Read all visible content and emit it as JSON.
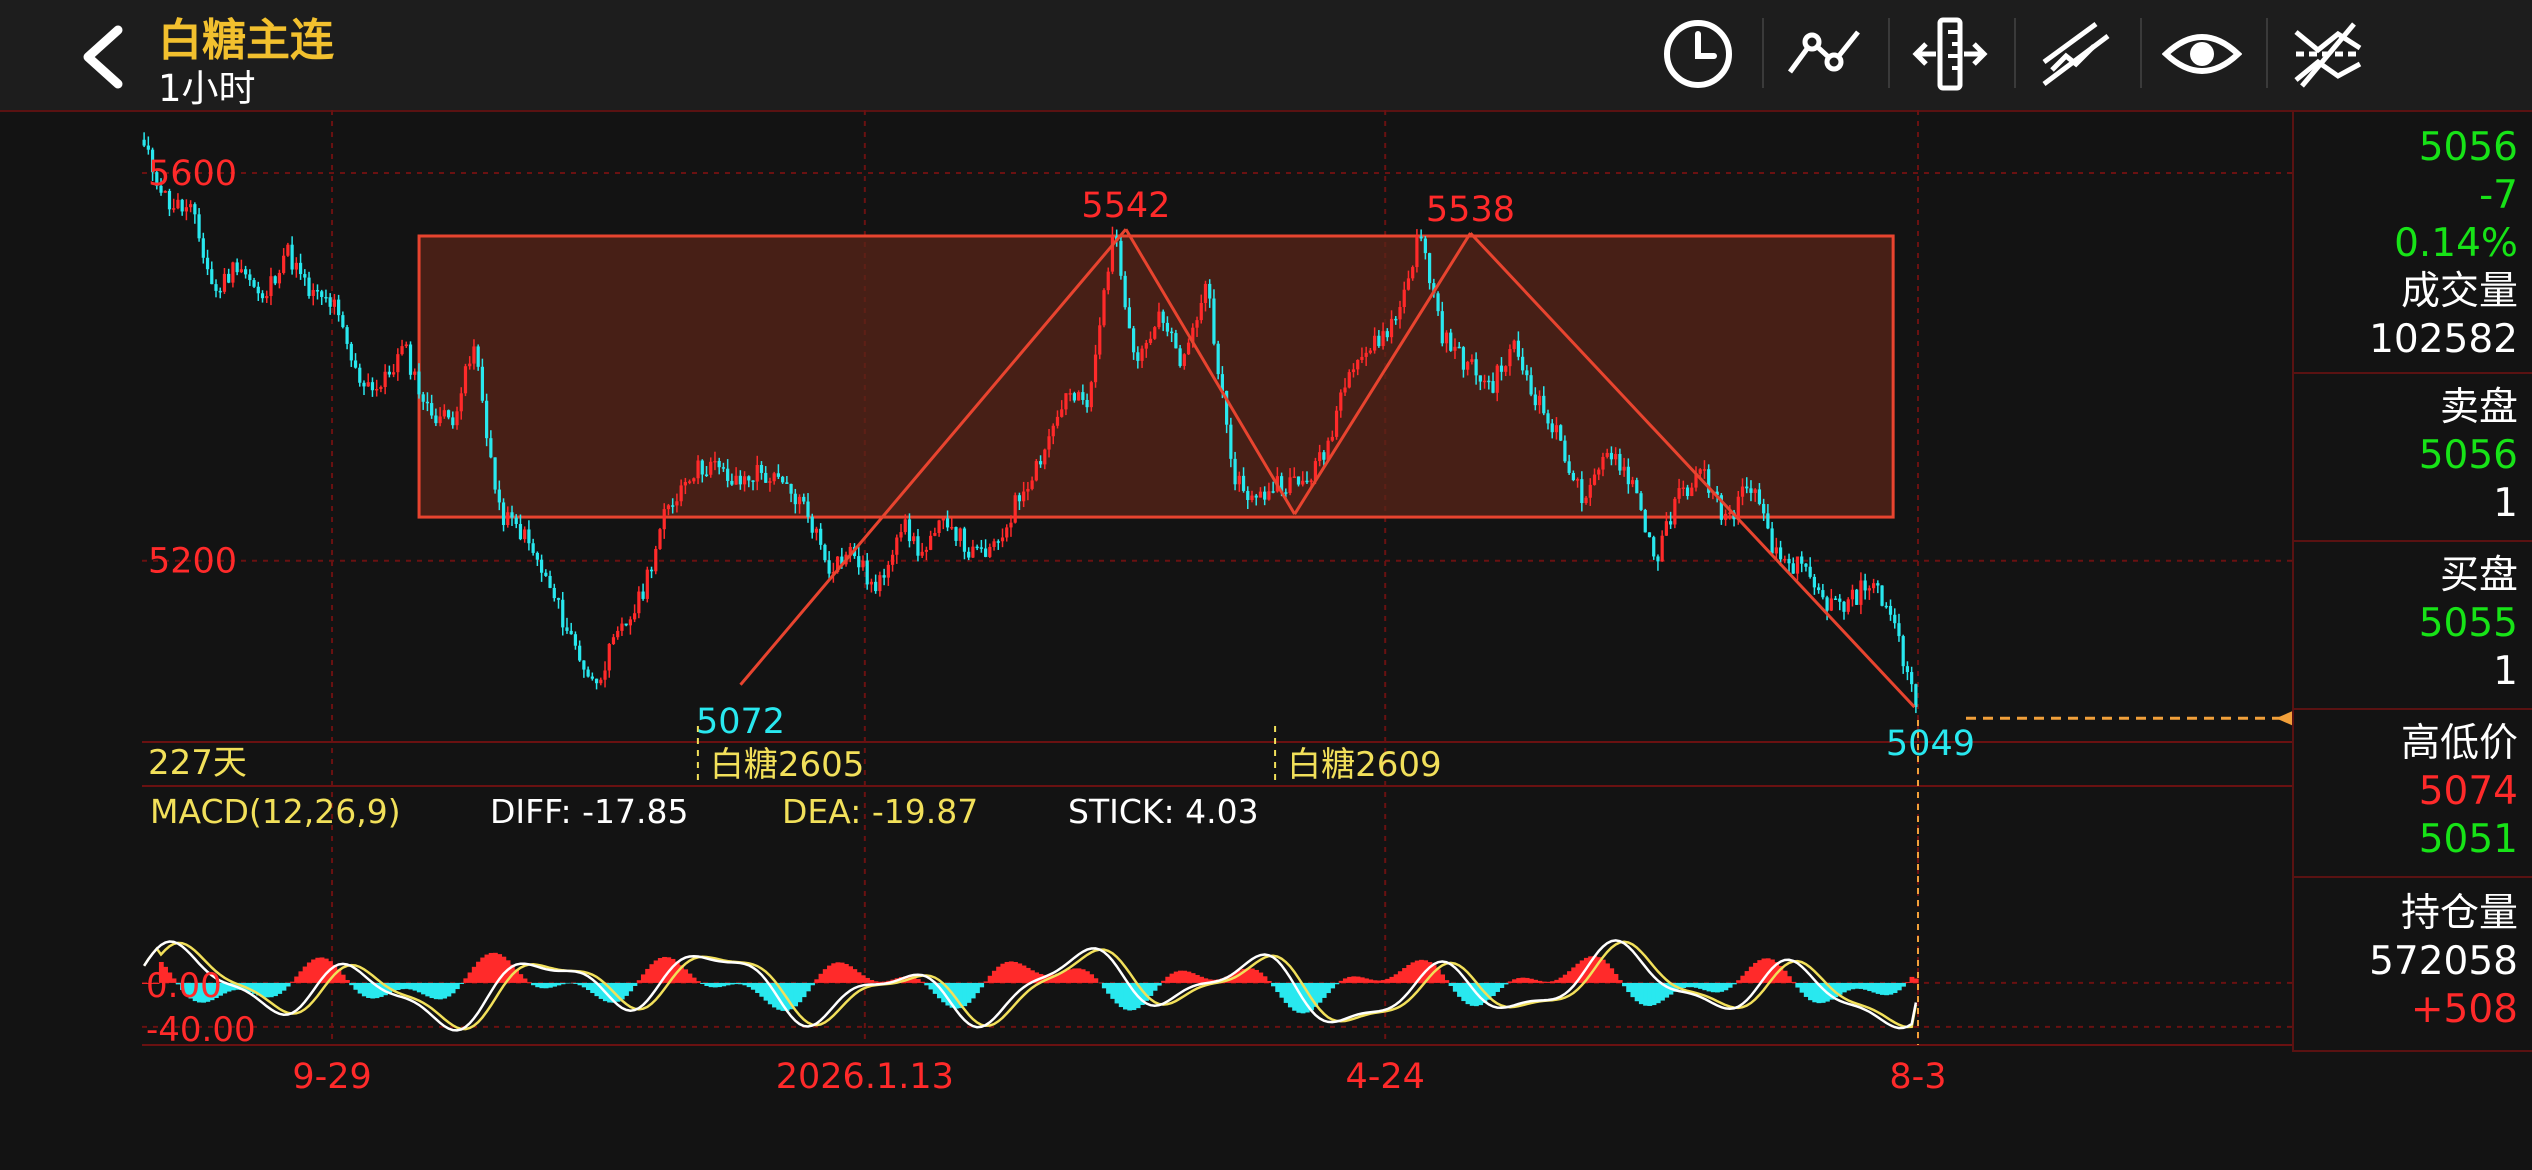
{
  "header": {
    "title": "白糖主连",
    "subtitle": "1小时",
    "tools": [
      "clock-icon",
      "line-draw-icon",
      "ruler-icon",
      "parallel-lines-icon",
      "eye-icon",
      "hide-drawings-icon"
    ]
  },
  "colors": {
    "up": "#ff2a2a",
    "down": "#29e8ef",
    "box_stroke": "#e8442f",
    "box_fill": "#5a2418",
    "diff_line": "#ffffff",
    "dea_line": "#f2e05a",
    "grid": "#6a1111",
    "price_green": "#17e317",
    "yellow": "#f2e05a",
    "orange": "#f2a03a"
  },
  "side": {
    "last_price": "5056",
    "change": "-7",
    "change_pct": "0.14%",
    "volume_label": "成交量",
    "volume": "102582",
    "sell_label": "卖盘",
    "sell_price": "5056",
    "sell_qty": "1",
    "buy_label": "买盘",
    "buy_price": "5055",
    "buy_qty": "1",
    "hl_label": "高低价",
    "high": "5074",
    "low": "5051",
    "oi_label": "持仓量",
    "open_interest": "572058",
    "oi_change": "+508"
  },
  "chart_data": [
    {
      "type": "candlestick",
      "title": "白糖主连 1小时",
      "y_ticks": [
        5600,
        5200
      ],
      "ylim": [
        5015,
        5665
      ],
      "x_tick_labels": [
        "9-29",
        "2026.1.13",
        "4-24",
        "8-3"
      ],
      "x_tick_fraction": [
        0.107,
        0.407,
        0.7,
        1.0
      ],
      "price_waypoints": [
        5625,
        5570,
        5560,
        5475,
        5510,
        5465,
        5522,
        5475,
        5465,
        5390,
        5378,
        5420,
        5355,
        5345,
        5420,
        5250,
        5230,
        5180,
        5125,
        5072,
        5118,
        5160,
        5243,
        5290,
        5300,
        5278,
        5292,
        5277,
        5255,
        5195,
        5210,
        5165,
        5240,
        5205,
        5245,
        5205,
        5210,
        5265,
        5310,
        5370,
        5360,
        5542,
        5410,
        5450,
        5400,
        5490,
        5295,
        5260,
        5282,
        5278,
        5310,
        5405,
        5420,
        5450,
        5538,
        5430,
        5403,
        5380,
        5420,
        5365,
        5320,
        5255,
        5318,
        5282,
        5200,
        5270,
        5290,
        5240,
        5282,
        5205,
        5195,
        5160,
        5150,
        5180,
        5145,
        5049
      ],
      "annotations": [
        {
          "label": "5600",
          "value": 5600
        },
        {
          "label": "5200",
          "value": 5200
        },
        {
          "label": "5542",
          "value": 5542,
          "at": 0.554
        },
        {
          "label": "5538",
          "value": 5538,
          "at": 0.748
        },
        {
          "label": "5072",
          "value": 5072,
          "at": 0.337
        },
        {
          "label": "5049",
          "value": 5049,
          "at": 0.998
        }
      ],
      "range_box": {
        "from": 0.156,
        "to": 0.986,
        "top": 5535,
        "bottom": 5245
      },
      "trend_lines": [
        {
          "x": [
            0.337,
            0.554
          ],
          "y": [
            5072,
            5542
          ]
        },
        {
          "x": [
            0.554,
            0.649
          ],
          "y": [
            5542,
            5248
          ]
        },
        {
          "x": [
            0.649,
            0.748
          ],
          "y": [
            5248,
            5538
          ]
        },
        {
          "x": [
            0.748,
            0.998
          ],
          "y": [
            5538,
            5049
          ]
        }
      ],
      "last_price_marker": 5056,
      "contract_labels": [
        {
          "label": "227天",
          "at": 0.0
        },
        {
          "label": "白糖2605",
          "at": 0.313
        },
        {
          "label": "白糖2609",
          "at": 0.638
        }
      ]
    },
    {
      "type": "bar",
      "title": "MACD(12,26,9)",
      "diff_label": "DIFF: -17.85",
      "dea_label": "DEA: -19.87",
      "stick_label": "STICK: 4.03",
      "y_ticks": [
        "0.00",
        "-40.00"
      ],
      "ylim": [
        -52,
        50
      ],
      "diff": -17.85,
      "dea": -19.87,
      "stick": 4.03
    }
  ]
}
